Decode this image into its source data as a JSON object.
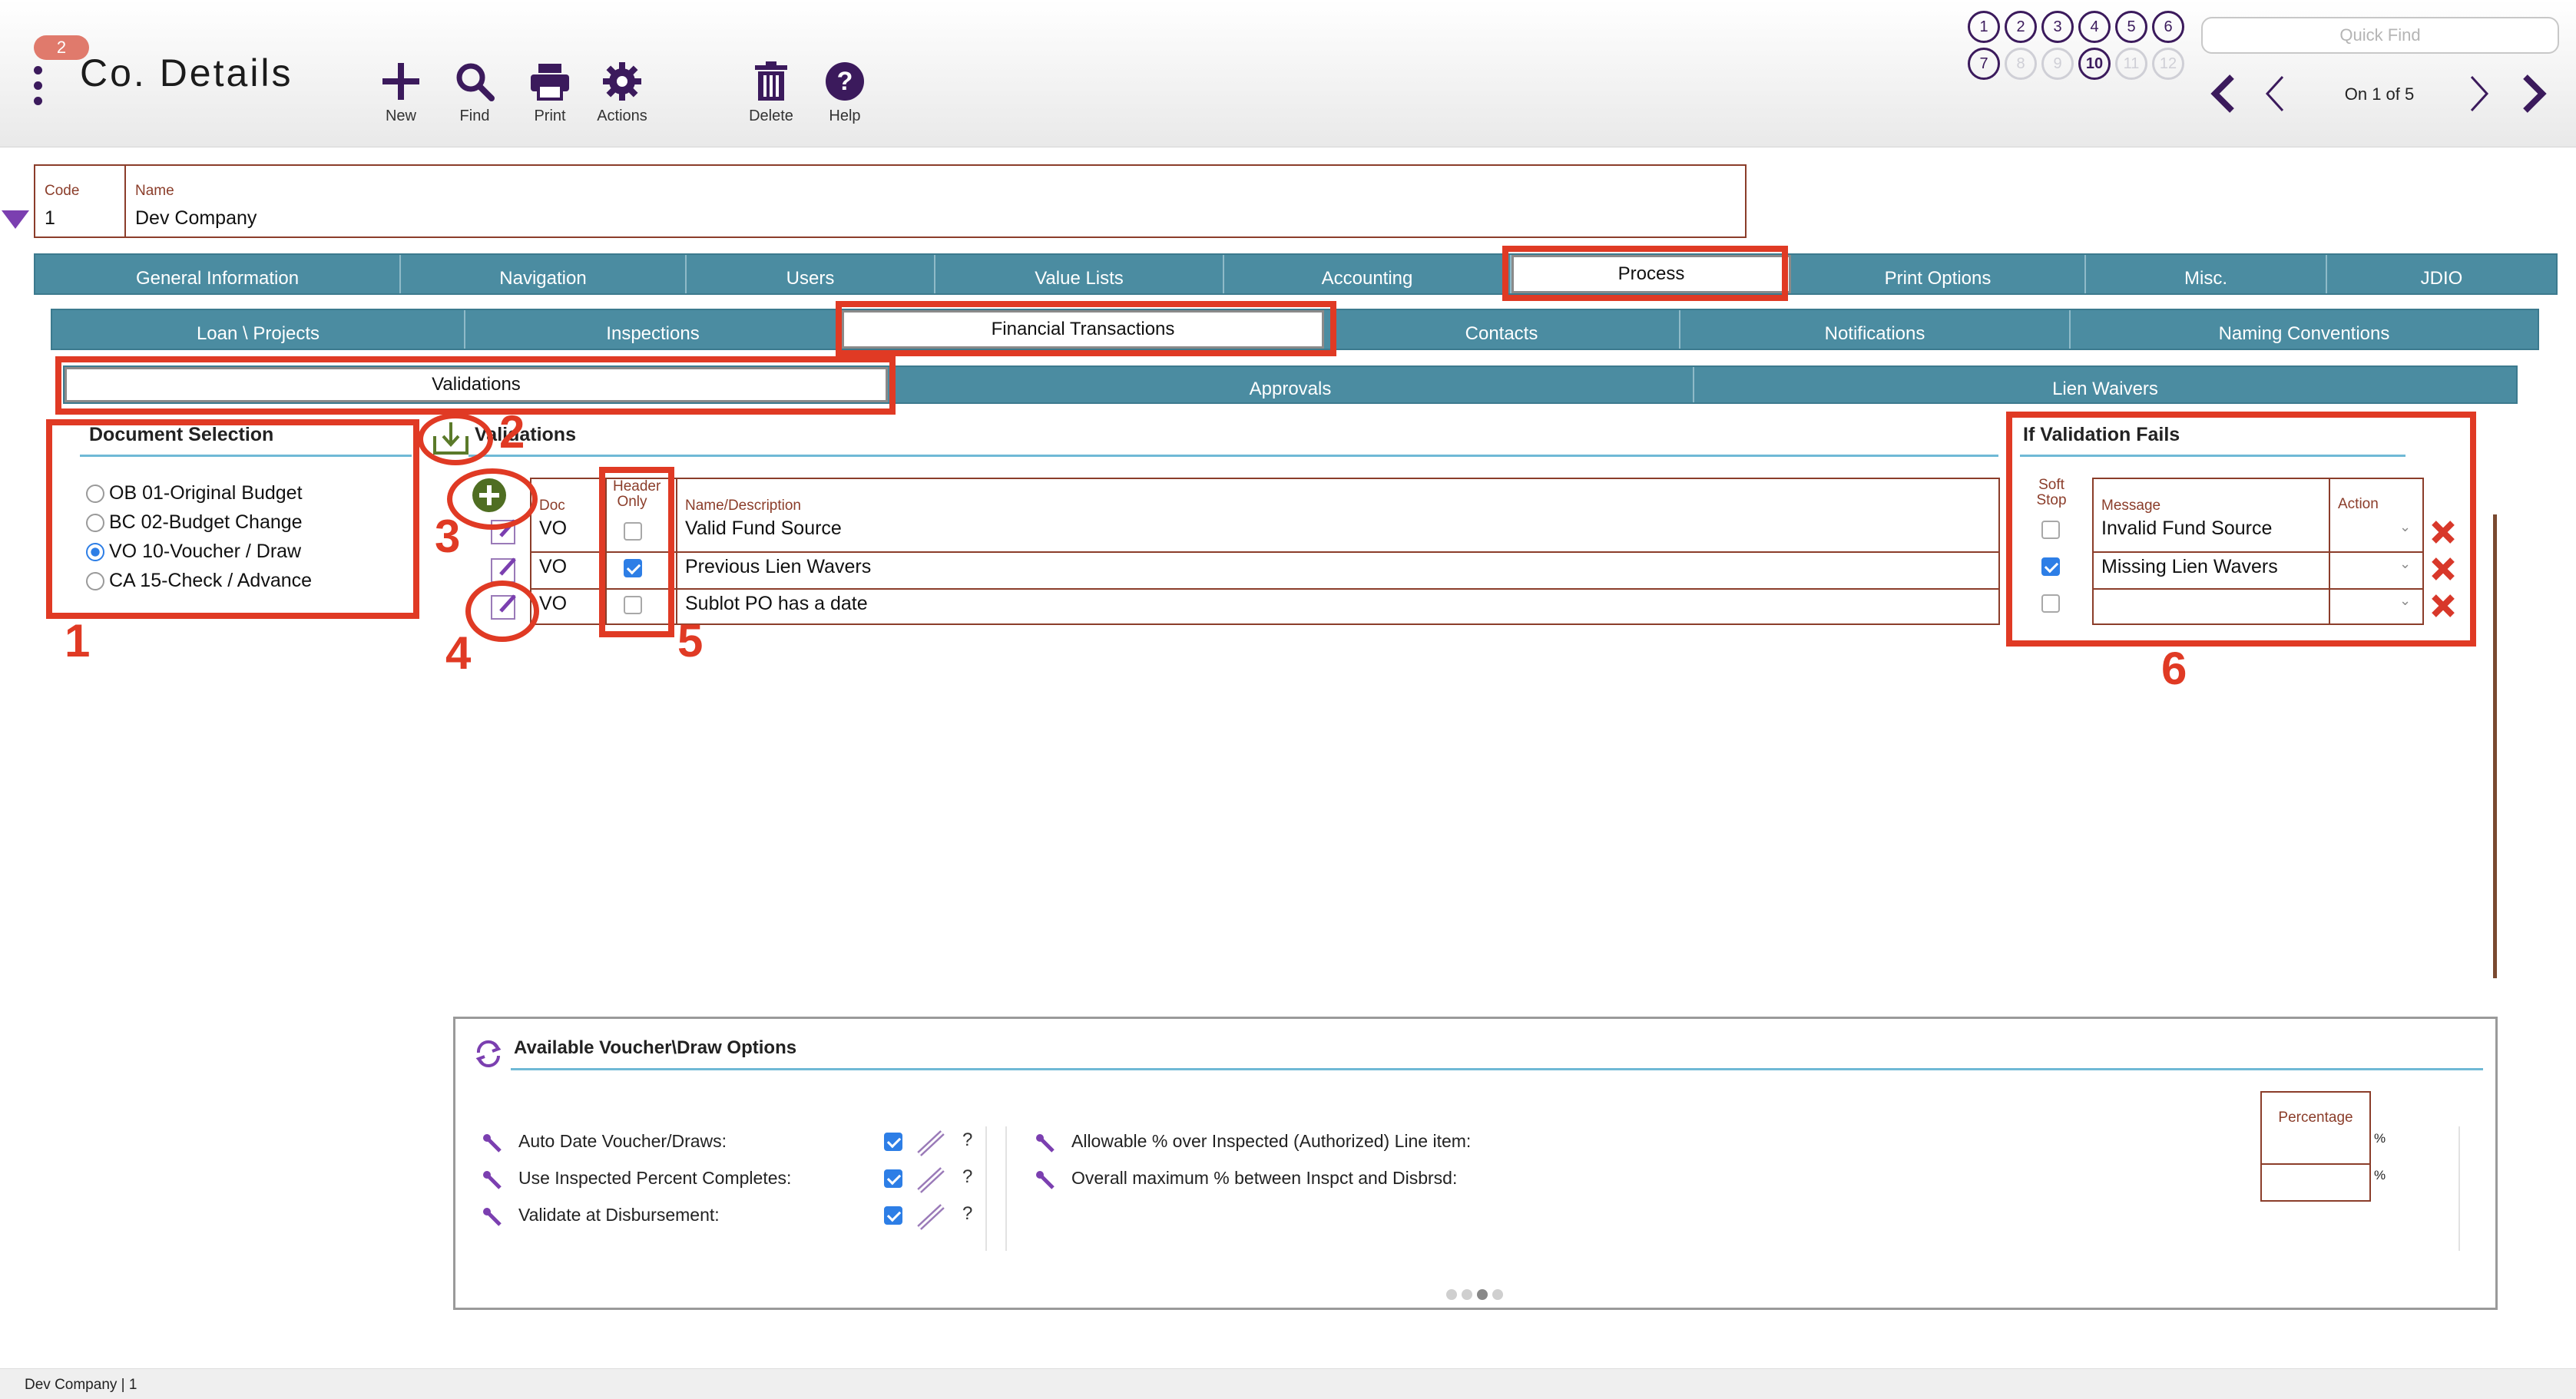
{
  "header": {
    "badge": "2",
    "title": "Co. Details",
    "toolbar": [
      {
        "label": "New",
        "icon": "plus-icon"
      },
      {
        "label": "Find",
        "icon": "search-icon"
      },
      {
        "label": "Print",
        "icon": "printer-icon"
      },
      {
        "label": "Actions",
        "icon": "gear-icon"
      },
      {
        "label": "Delete",
        "icon": "trash-icon"
      },
      {
        "label": "Help",
        "icon": "help-icon"
      }
    ],
    "records": [
      "1",
      "2",
      "3",
      "4",
      "5",
      "6",
      "7",
      "8",
      "9",
      "10",
      "11",
      "12"
    ],
    "quick_find_placeholder": "Quick Find",
    "pager_text": "On 1 of 5"
  },
  "record": {
    "code_label": "Code",
    "code_value": "1",
    "name_label": "Name",
    "name_value": "Dev Company"
  },
  "main_tabs": [
    "General Information",
    "Navigation",
    "Users",
    "Value Lists",
    "Accounting",
    "Process",
    "Print Options",
    "Misc.",
    "JDIO"
  ],
  "sub_tabs": [
    "Loan \\ Projects",
    "Inspections",
    "Financial Transactions",
    "Contacts",
    "Notifications",
    "Naming Conventions"
  ],
  "third_tabs": [
    "Validations",
    "Approvals",
    "Lien Waivers"
  ],
  "document_selection": {
    "title": "Document Selection",
    "options": [
      {
        "label": "OB 01-Original Budget",
        "selected": false
      },
      {
        "label": "BC 02-Budget Change",
        "selected": false
      },
      {
        "label": "VO 10-Voucher / Draw",
        "selected": true
      },
      {
        "label": "CA 15-Check / Advance",
        "selected": false
      }
    ]
  },
  "validations": {
    "title": "Validations",
    "col_doc": "Doc",
    "col_header_only_1": "Header",
    "col_header_only_2": "Only",
    "col_name": "Name/Description",
    "rows": [
      {
        "doc": "VO",
        "header_only": false,
        "name": "Valid Fund Source"
      },
      {
        "doc": "VO",
        "header_only": true,
        "name": "Previous Lien Wavers"
      },
      {
        "doc": "VO",
        "header_only": false,
        "name": "Sublot PO has a date"
      }
    ]
  },
  "if_fails": {
    "title": "If Validation Fails",
    "col_soft_1": "Soft",
    "col_soft_2": "Stop",
    "col_message": "Message",
    "col_action": "Action",
    "rows": [
      {
        "soft_stop": false,
        "message": "Invalid Fund Source"
      },
      {
        "soft_stop": true,
        "message": "Missing Lien Wavers"
      },
      {
        "soft_stop": false,
        "message": ""
      }
    ]
  },
  "annotations": [
    "1",
    "2",
    "3",
    "4",
    "5",
    "6"
  ],
  "options_panel": {
    "title": "Available Voucher\\Draw Options",
    "left_items": [
      {
        "label": "Auto Date Voucher/Draws:",
        "checked": true
      },
      {
        "label": "Use Inspected Percent Completes:",
        "checked": true
      },
      {
        "label": "Validate at Disbursement:",
        "checked": true
      }
    ],
    "question_mark": "?",
    "right_items": [
      "Allowable % over Inspected (Authorized) Line item:",
      "Overall maximum % between Inspct and Disbrsd:"
    ],
    "percentage_label": "Percentage",
    "percent_sign": "%"
  },
  "footer": "Dev Company | 1",
  "colors": {
    "accent": "#3b1a5c",
    "tab": "#4b8ca1",
    "annotation": "#e03a24",
    "field_border": "#8b3d2a"
  }
}
